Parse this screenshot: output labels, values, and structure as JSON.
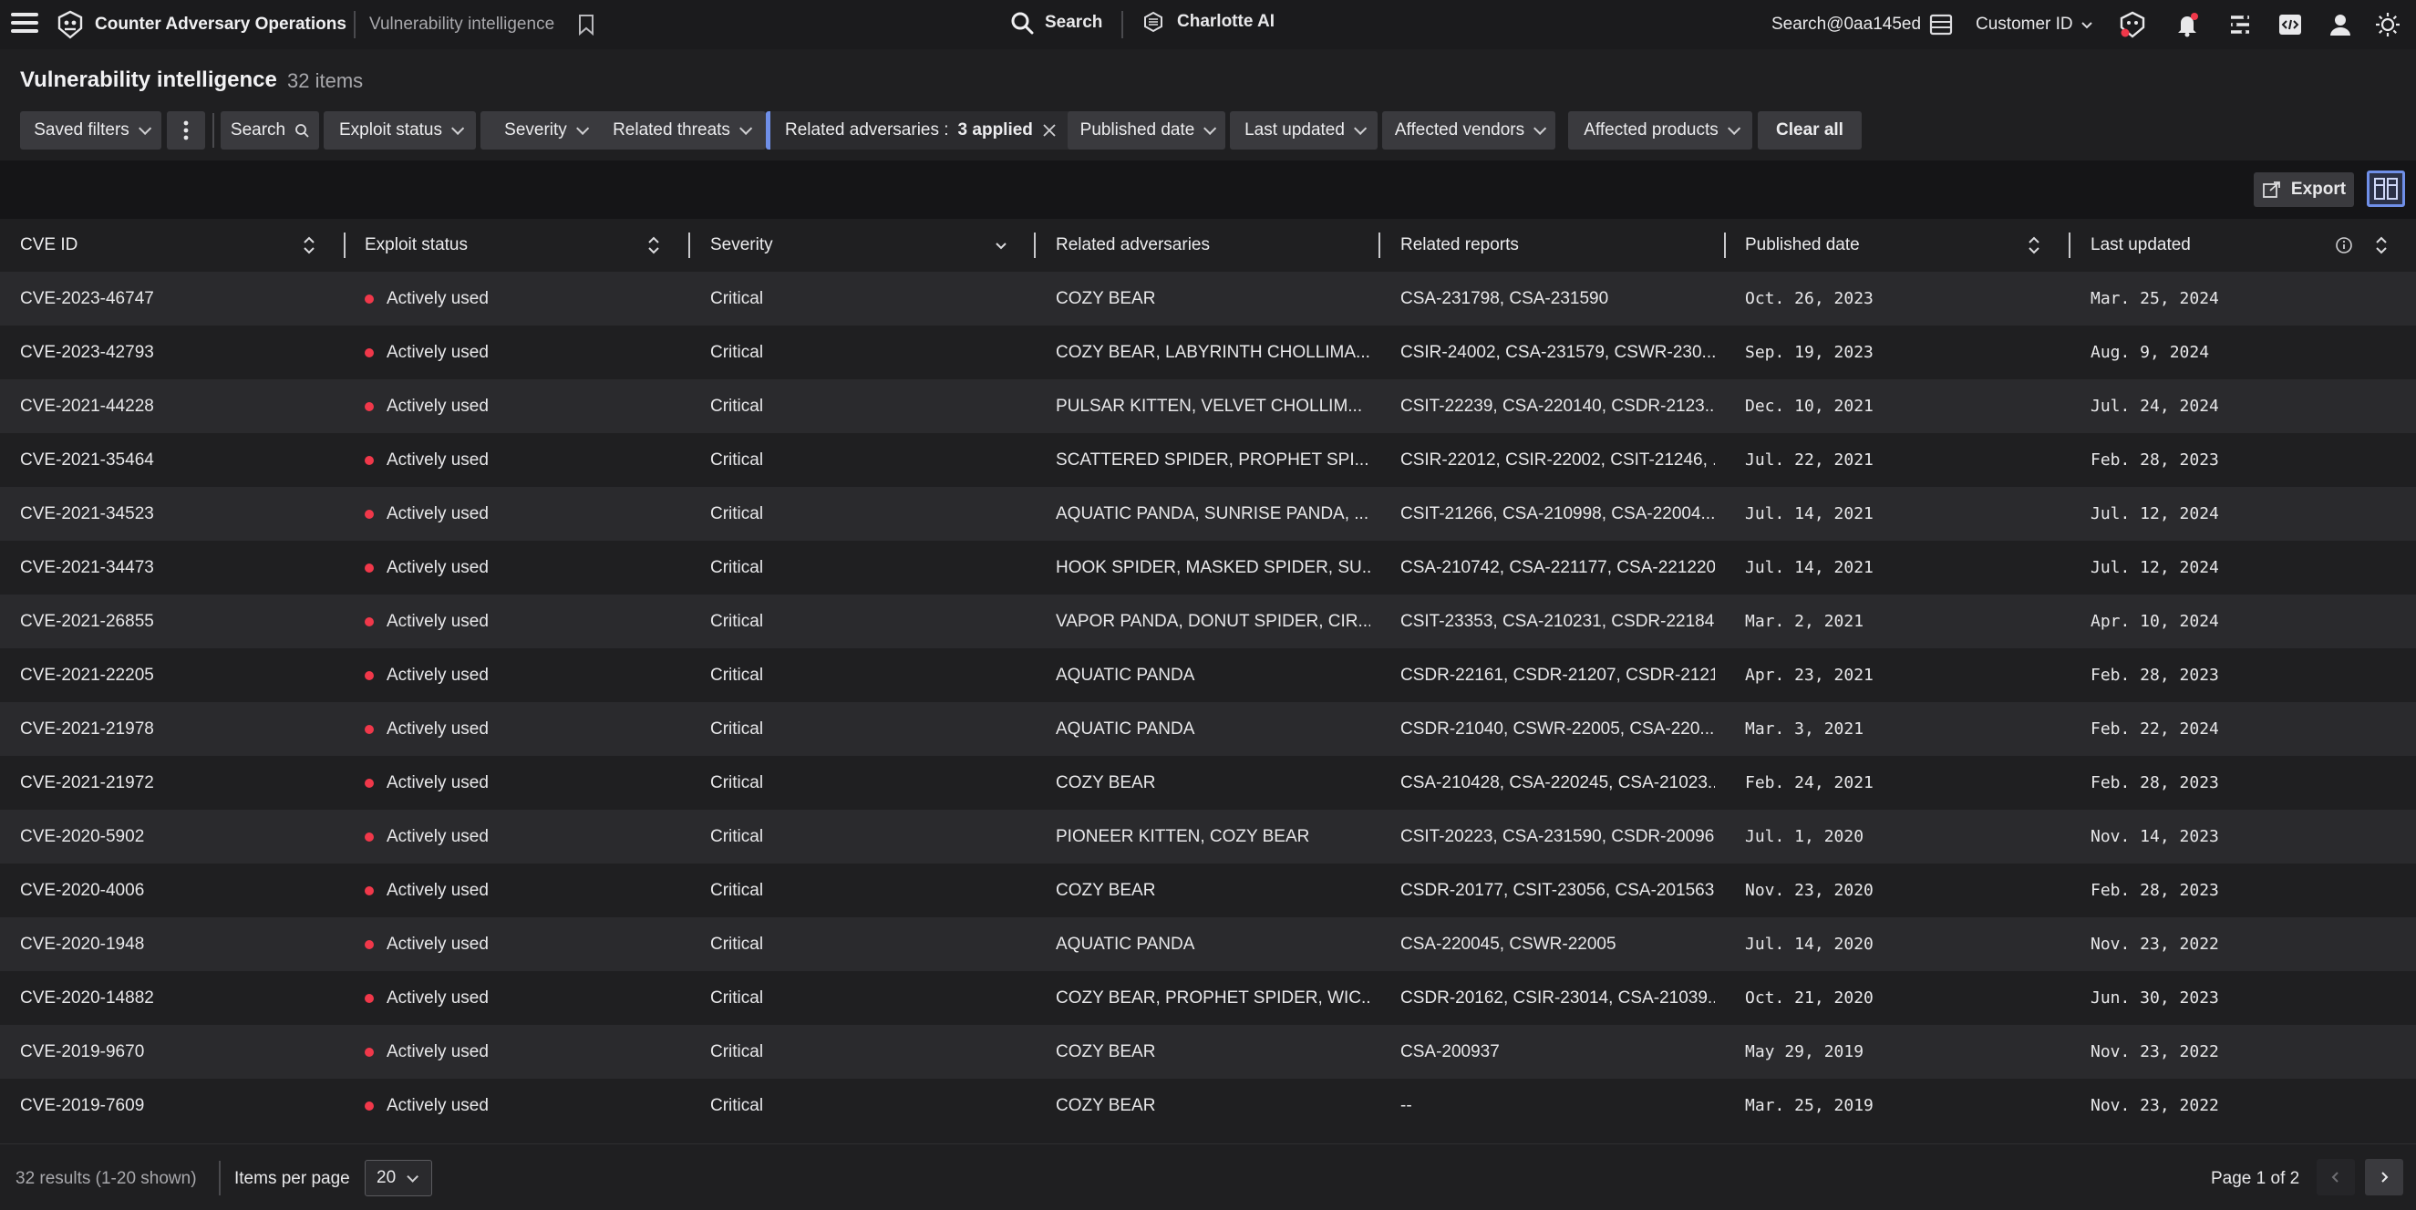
{
  "app": {
    "title": "Counter Adversary Operations",
    "breadcrumb": "Vulnerability intelligence",
    "search_label": "Search",
    "charlotte_label": "Charlotte AI",
    "user_search": "Search@0aa145ed",
    "customer_label": "Customer ID"
  },
  "page": {
    "title": "Vulnerability intelligence",
    "count": "32 items"
  },
  "filters": {
    "saved_filters": "Saved filters",
    "search": "Search",
    "exploit_status": "Exploit status",
    "severity": "Severity",
    "related_threats": "Related threats",
    "related_adversaries_label": "Related adversaries :",
    "related_adversaries_value": "3 applied",
    "published_date": "Published date",
    "last_updated": "Last updated",
    "affected_vendors": "Affected vendors",
    "affected_products": "Affected products",
    "clear_all": "Clear all"
  },
  "toolbar": {
    "export_label": "Export"
  },
  "table": {
    "columns": [
      "CVE ID",
      "Exploit status",
      "Severity",
      "Related adversaries",
      "Related reports",
      "Published date",
      "Last updated"
    ],
    "rows": [
      [
        "CVE-2023-46747",
        "Actively used",
        "Critical",
        "COZY BEAR",
        "CSA-231798, CSA-231590",
        "Oct. 26, 2023",
        "Mar. 25, 2024"
      ],
      [
        "CVE-2023-42793",
        "Actively used",
        "Critical",
        "COZY BEAR, LABYRINTH CHOLLIMA...",
        "CSIR-24002, CSA-231579, CSWR-230...",
        "Sep. 19, 2023",
        "Aug. 9, 2024"
      ],
      [
        "CVE-2021-44228",
        "Actively used",
        "Critical",
        "PULSAR KITTEN, VELVET CHOLLIM...",
        "CSIT-22239, CSA-220140, CSDR-2123...",
        "Dec. 10, 2021",
        "Jul. 24, 2024"
      ],
      [
        "CVE-2021-35464",
        "Actively used",
        "Critical",
        "SCATTERED SPIDER, PROPHET SPI...",
        "CSIR-22012, CSIR-22002, CSIT-21246, ...",
        "Jul. 22, 2021",
        "Feb. 28, 2023"
      ],
      [
        "CVE-2021-34523",
        "Actively used",
        "Critical",
        "AQUATIC PANDA, SUNRISE PANDA, ...",
        "CSIT-21266, CSA-210998, CSA-22004...",
        "Jul. 14, 2021",
        "Jul. 12, 2024"
      ],
      [
        "CVE-2021-34473",
        "Actively used",
        "Critical",
        "HOOK SPIDER, MASKED SPIDER, SU...",
        "CSA-210742, CSA-221177, CSA-221220...",
        "Jul. 14, 2021",
        "Jul. 12, 2024"
      ],
      [
        "CVE-2021-26855",
        "Actively used",
        "Critical",
        "VAPOR PANDA, DONUT SPIDER, CIR...",
        "CSIT-23353, CSA-210231, CSDR-22184...",
        "Mar. 2, 2021",
        "Apr. 10, 2024"
      ],
      [
        "CVE-2021-22205",
        "Actively used",
        "Critical",
        "AQUATIC PANDA",
        "CSDR-22161, CSDR-21207, CSDR-2121...",
        "Apr. 23, 2021",
        "Feb. 28, 2023"
      ],
      [
        "CVE-2021-21978",
        "Actively used",
        "Critical",
        "AQUATIC PANDA",
        "CSDR-21040, CSWR-22005, CSA-220...",
        "Mar. 3, 2021",
        "Feb. 22, 2024"
      ],
      [
        "CVE-2021-21972",
        "Actively used",
        "Critical",
        "COZY BEAR",
        "CSA-210428, CSA-220245, CSA-21023...",
        "Feb. 24, 2021",
        "Feb. 28, 2023"
      ],
      [
        "CVE-2020-5902",
        "Actively used",
        "Critical",
        "PIONEER KITTEN, COZY BEAR",
        "CSIT-20223, CSA-231590, CSDR-20096",
        "Jul. 1, 2020",
        "Nov. 14, 2023"
      ],
      [
        "CVE-2020-4006",
        "Actively used",
        "Critical",
        "COZY BEAR",
        "CSDR-20177, CSIT-23056, CSA-201563",
        "Nov. 23, 2020",
        "Feb. 28, 2023"
      ],
      [
        "CVE-2020-1948",
        "Actively used",
        "Critical",
        "AQUATIC PANDA",
        "CSA-220045, CSWR-22005",
        "Jul. 14, 2020",
        "Nov. 23, 2022"
      ],
      [
        "CVE-2020-14882",
        "Actively used",
        "Critical",
        "COZY BEAR, PROPHET SPIDER, WIC...",
        "CSDR-20162, CSIR-23014, CSA-21039...",
        "Oct. 21, 2020",
        "Jun. 30, 2023"
      ],
      [
        "CVE-2019-9670",
        "Actively used",
        "Critical",
        "COZY BEAR",
        "CSA-200937",
        "May 29, 2019",
        "Nov. 23, 2022"
      ],
      [
        "CVE-2019-7609",
        "Actively used",
        "Critical",
        "COZY BEAR",
        "--",
        "Mar. 25, 2019",
        "Nov. 23, 2022"
      ]
    ]
  },
  "footer": {
    "results": "32 results (1-20 shown)",
    "items_per_page_label": "Items per page",
    "items_per_page_value": "20",
    "page_label": "Page 1 of 2"
  },
  "icons": {
    "menu": "hamburger-menu-icon",
    "logo": "falcon-logo-icon",
    "bookmark": "bookmark-icon",
    "search": "search-icon",
    "charlotte": "charlotte-ai-icon",
    "layout": "table-layout-icon",
    "notifications": "bell-icon",
    "export": "export-icon"
  },
  "colors": {
    "status_dot": "#f0384a",
    "accent": "#6f8fe8",
    "notification_badge": "#f0384a"
  }
}
